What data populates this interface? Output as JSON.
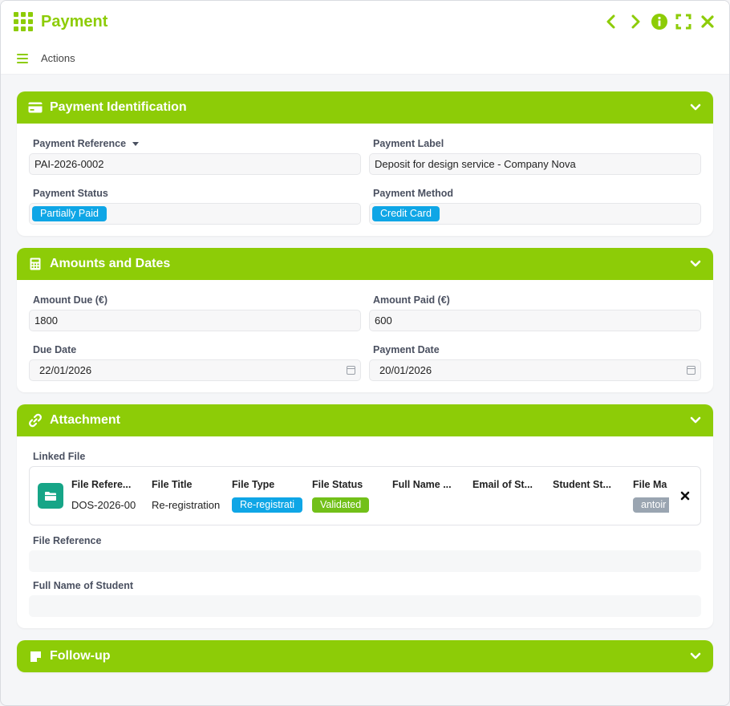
{
  "window": {
    "title": "Payment"
  },
  "actions_label": "Actions",
  "sections": {
    "identification": {
      "title": "Payment Identification",
      "payment_reference": {
        "label": "Payment Reference",
        "value": "PAI-2026-0002"
      },
      "payment_label": {
        "label": "Payment Label",
        "value": "Deposit for design service - Company Nova"
      },
      "payment_status": {
        "label": "Payment Status",
        "value": "Partially Paid"
      },
      "payment_method": {
        "label": "Payment Method",
        "value": "Credit Card"
      }
    },
    "amounts": {
      "title": "Amounts and Dates",
      "amount_due": {
        "label": "Amount Due (€)",
        "value": "1800"
      },
      "amount_paid": {
        "label": "Amount Paid (€)",
        "value": "600"
      },
      "due_date": {
        "label": "Due Date",
        "value": "22/01/2026"
      },
      "payment_date": {
        "label": "Payment Date",
        "value": "20/01/2026"
      }
    },
    "attachment": {
      "title": "Attachment",
      "linked_file_label": "Linked File",
      "columns": [
        "File Refere...",
        "File Title",
        "File Type",
        "File Status",
        "Full Name ...",
        "Email of St...",
        "Student St...",
        "File Ma"
      ],
      "row": {
        "file_reference": "DOS-2026-00",
        "file_title": "Re-registration",
        "file_type": "Re-registrati",
        "file_status": "Validated",
        "file_manager": "antoir"
      },
      "file_reference_label": "File Reference",
      "full_name_label": "Full Name of Student"
    },
    "followup": {
      "title": "Follow-up"
    }
  },
  "colors": {
    "accent": "#8dcc07",
    "tag_blue": "#0fa6e6",
    "tag_green": "#72c019",
    "tag_grey": "#9aa5b1",
    "folder_badge": "#16a587"
  }
}
